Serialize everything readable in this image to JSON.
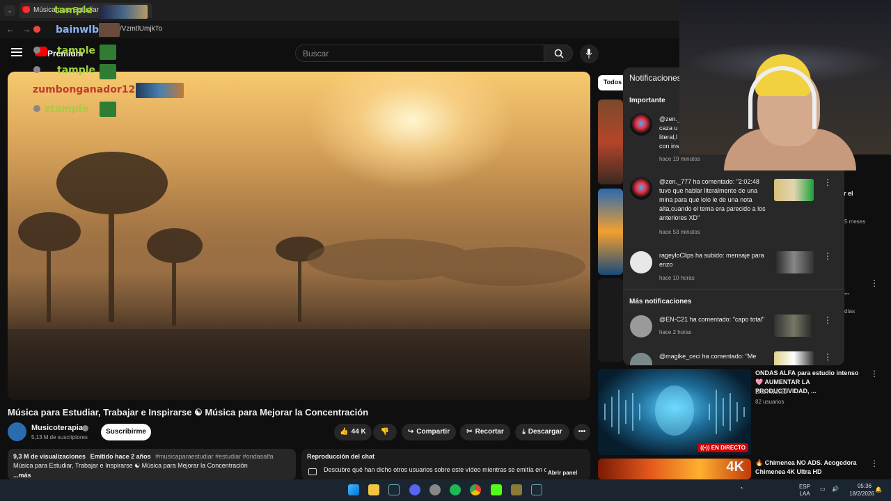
{
  "browser": {
    "tab_label": "Música para Estudiar...",
    "url": "/VzmtlUmjkTo"
  },
  "header": {
    "logo_text": "Premium",
    "search_placeholder": "Buscar"
  },
  "overlay_chat": {
    "names": [
      "tample",
      "bainwlb:",
      "tample",
      "tample",
      "zumbonganador123",
      "ztample"
    ]
  },
  "video": {
    "title": "Música para Estudiar, Trabajar e Inspirarse ☯ Música para Mejorar la Concentración",
    "channel": "Musicoterapia",
    "subscribers": "5,13 M de suscriptores",
    "subscribe_label": "Suscribirme",
    "likes": "44 K",
    "share_label": "Compartir",
    "clip_label": "Recortar",
    "download_label": "Descargar",
    "more_label": "•••"
  },
  "description": {
    "stats": "9,3 M de visualizaciones",
    "emitted": "Emitido hace 2 años",
    "tags": "#musicaparaestudiar #estudiar #ondasalfa",
    "line2": "Música para Estudiar, Trabajar e Inspirarse ☯ Música para Mejorar la Concentración",
    "more": "...más"
  },
  "chat_replay": {
    "title": "Reproducción del chat",
    "text": "Descubre qué han dicho otros usuarios sobre este vídeo mientras se emitía en directo",
    "open_panel": "Abrir panel"
  },
  "chips": {
    "all": "Todos"
  },
  "notifications": {
    "header": "Notificaciones",
    "important_label": "Importante",
    "more_label": "Más notificaciones",
    "items": [
      {
        "text": "@zen._ caza u literal,l con ins",
        "time": "hace 19 minutos"
      },
      {
        "text": "@zen._777 ha comentado: \"2:02:48 tuvo que hablar literalmente de una mina para que lolo le de una nota alta,cuando el tema era parecido a los anteriores XD\"",
        "time": "hace 53 minutos"
      },
      {
        "text": "rageyloClips ha subido: mensaje para enzo",
        "time": "hace 10 horas"
      },
      {
        "text": "@EN-C21 ha comentado: \"capo total\"",
        "time": "hace 2 horas"
      },
      {
        "text": "@magike_ceci ha comentado: \"Me",
        "time": ""
      }
    ]
  },
  "recommendations": [
    {
      "title": "r el",
      "meta": "5 meses"
    },
    {
      "title": "...",
      "meta": "días"
    },
    {
      "title": "ONDAS ALFA para estudio intenso 🩷 AUMENTAR LA PRODUCTIVIDAD, ...",
      "channel": "Brain Waves",
      "meta": "82 usuarios",
      "badge": "EN DIRECTO"
    },
    {
      "title": "🔥 Chimenea NO ADS. Acogedora Chimenea 4K Ultra HD",
      "badge": "4K"
    }
  ],
  "taskbar": {
    "lang_top": "ESP",
    "lang_bottom": "LAA",
    "time": "05:36",
    "date": "18/2/2026"
  },
  "colors": {
    "background": "#0f0f0f",
    "panel": "#282828",
    "accent": "#ff0000",
    "live_badge": "#cc0000"
  }
}
